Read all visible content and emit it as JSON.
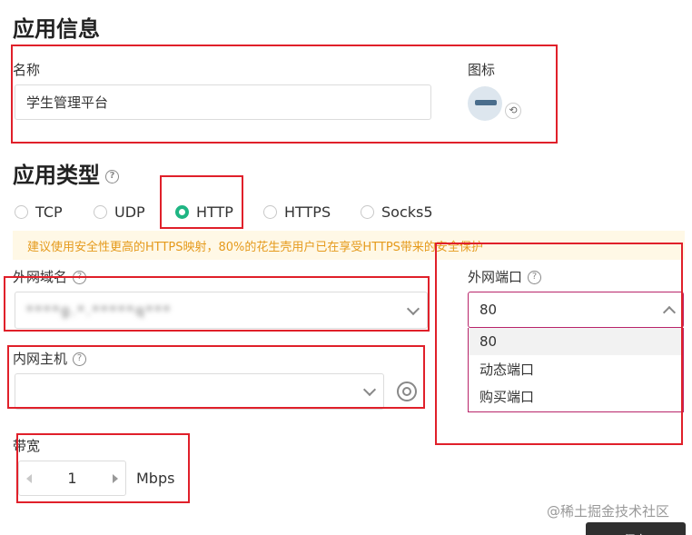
{
  "app_info": {
    "title": "应用信息",
    "name_label": "名称",
    "name_value": "学生管理平台",
    "icon_label": "图标"
  },
  "app_type": {
    "title": "应用类型",
    "help_icon": "question-circle-icon",
    "options": [
      {
        "label": "TCP",
        "selected": false
      },
      {
        "label": "UDP",
        "selected": false
      },
      {
        "label": "HTTP",
        "selected": true
      },
      {
        "label": "HTTPS",
        "selected": false
      },
      {
        "label": "Socks5",
        "selected": false
      }
    ],
    "warning": "建议使用安全性更高的HTTPS映射，80%的花生壳用户已在享受HTTPS带来的安全保护"
  },
  "external_domain": {
    "label": "外网域名",
    "value": "****g.*.*****q***"
  },
  "external_port": {
    "label": "外网端口",
    "value": "80",
    "options": [
      "80",
      "动态端口",
      "购买端口"
    ]
  },
  "internal_host": {
    "label": "内网主机",
    "value": ""
  },
  "bandwidth": {
    "label": "带宽",
    "value": "1",
    "unit": "Mbps"
  },
  "watermark": "@稀土掘金技术社区",
  "save_label": "保存",
  "colors": {
    "accent": "#1fb583",
    "highlight_border": "#e0202a",
    "focus_border": "#b8246a",
    "warning_text": "#e59a1c",
    "warning_bg": "#fff8e6"
  }
}
